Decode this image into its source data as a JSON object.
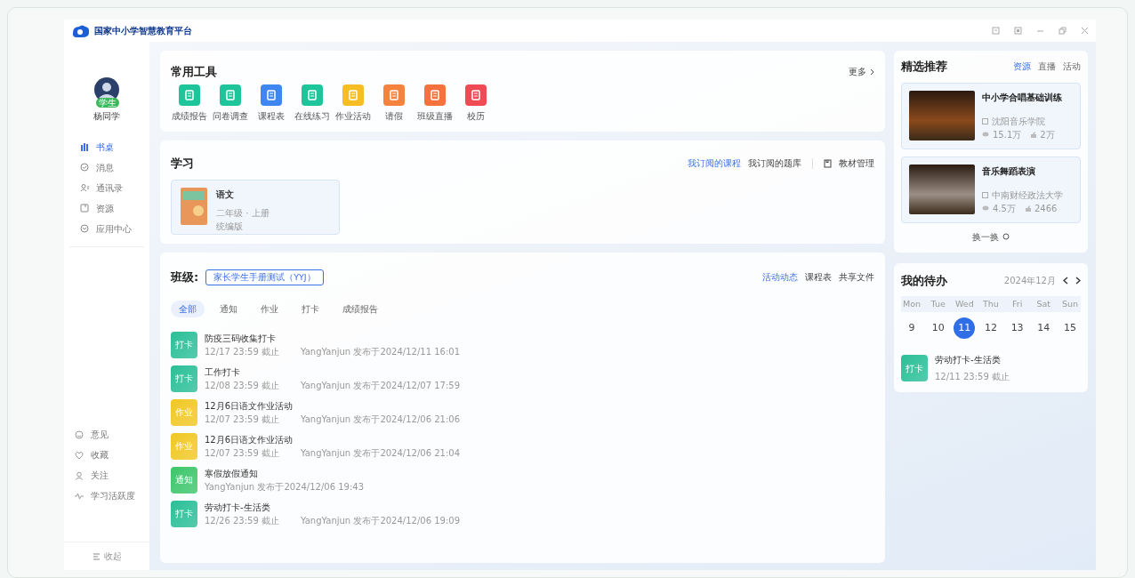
{
  "window": {
    "title": "国家中小学智慧教育平台"
  },
  "sidebar": {
    "user": {
      "name": "杨同学",
      "badge": "学生"
    },
    "nav": [
      {
        "label": "书桌",
        "selected": true
      },
      {
        "label": "消息",
        "selected": false
      },
      {
        "label": "通讯录",
        "selected": false
      },
      {
        "label": "资源",
        "selected": false
      },
      {
        "label": "应用中心",
        "selected": false
      }
    ],
    "bottom": [
      {
        "label": "意见"
      },
      {
        "label": "收藏"
      },
      {
        "label": "关注"
      },
      {
        "label": "学习活跃度"
      }
    ],
    "collapse": "收起"
  },
  "tools": {
    "title": "常用工具",
    "more": "更多",
    "items": [
      {
        "label": "成绩报告",
        "color": "#1fc59a"
      },
      {
        "label": "问卷调查",
        "color": "#1fc59a"
      },
      {
        "label": "课程表",
        "color": "#3f86f0"
      },
      {
        "label": "在线练习",
        "color": "#1fc59a"
      },
      {
        "label": "作业活动",
        "color": "#f6bd24"
      },
      {
        "label": "请假",
        "color": "#f5823d"
      },
      {
        "label": "班级直播",
        "color": "#f5713d"
      },
      {
        "label": "校历",
        "color": "#ee4b55"
      }
    ]
  },
  "study": {
    "title": "学习",
    "tabs": [
      {
        "label": "我订阅的课程",
        "selected": true
      },
      {
        "label": "我订阅的题库",
        "selected": false
      }
    ],
    "manage": "教材管理",
    "courses": [
      {
        "title": "语文",
        "grade": "二年级 · 上册",
        "edition": "统编版"
      }
    ]
  },
  "class_section": {
    "title": "班级:",
    "class_name": "家长学生手册测试（YYJ）",
    "tabs": [
      {
        "label": "活动动态",
        "selected": true
      },
      {
        "label": "课程表",
        "selected": false
      },
      {
        "label": "共享文件",
        "selected": false
      }
    ],
    "filters": [
      {
        "label": "全部",
        "selected": true
      },
      {
        "label": "通知",
        "selected": false
      },
      {
        "label": "作业",
        "selected": false
      },
      {
        "label": "打卡",
        "selected": false
      },
      {
        "label": "成绩报告",
        "selected": false
      }
    ],
    "activities": [
      {
        "tag": "打卡",
        "color": "#2bbf98",
        "title": "防疫三码收集打卡",
        "deadline": "12/17 23:59 截止",
        "publisher": "YangYanjun 发布于2024/12/11 16:01"
      },
      {
        "tag": "打卡",
        "color": "#2bbf98",
        "title": "工作打卡",
        "deadline": "12/08 23:59 截止",
        "publisher": "YangYanjun 发布于2024/12/07 17:59"
      },
      {
        "tag": "作业",
        "color": "#f0c823",
        "title": "12月6日语文作业活动",
        "deadline": "12/07 23:59 截止",
        "publisher": "YangYanjun 发布于2024/12/06 21:06"
      },
      {
        "tag": "作业",
        "color": "#f0c823",
        "title": "12月6日语文作业活动",
        "deadline": "12/07 23:59 截止",
        "publisher": "YangYanjun 发布于2024/12/06 21:04"
      },
      {
        "tag": "通知",
        "color": "#3cc66a",
        "title": "寒假放假通知",
        "publisher": "YangYanjun 发布于2024/12/06 19:43"
      },
      {
        "tag": "打卡",
        "color": "#2bbf98",
        "title": "劳动打卡-生活类",
        "deadline": "12/26 23:59 截止",
        "publisher": "YangYanjun 发布于2024/12/06 19:09"
      }
    ]
  },
  "recommend": {
    "title": "精选推荐",
    "tabs": [
      {
        "label": "资源",
        "selected": true
      },
      {
        "label": "直播",
        "selected": false
      },
      {
        "label": "活动",
        "selected": false
      }
    ],
    "items": [
      {
        "title": "中小学合唱基础训练",
        "source": "沈阳音乐学院",
        "views": "15.1万",
        "likes": "2万"
      },
      {
        "title": "音乐舞蹈表演",
        "source": "中南财经政法大学",
        "views": "4.5万",
        "likes": "2466"
      }
    ],
    "refresh": "换一换"
  },
  "todo": {
    "title": "我的待办",
    "month": "2024年12月",
    "days": [
      {
        "weekday": "Mon",
        "date": "9",
        "selected": false
      },
      {
        "weekday": "Tue",
        "date": "10",
        "selected": false
      },
      {
        "weekday": "Wed",
        "date": "11",
        "selected": true
      },
      {
        "weekday": "Thu",
        "date": "12",
        "selected": false
      },
      {
        "weekday": "Fri",
        "date": "13",
        "selected": false
      },
      {
        "weekday": "Sat",
        "date": "14",
        "selected": false
      },
      {
        "weekday": "Sun",
        "date": "15",
        "selected": false
      }
    ],
    "items": [
      {
        "tag": "打卡",
        "color": "#2bbf98",
        "title": "劳动打卡-生活类",
        "deadline": "12/11 23:59 截止"
      }
    ]
  }
}
